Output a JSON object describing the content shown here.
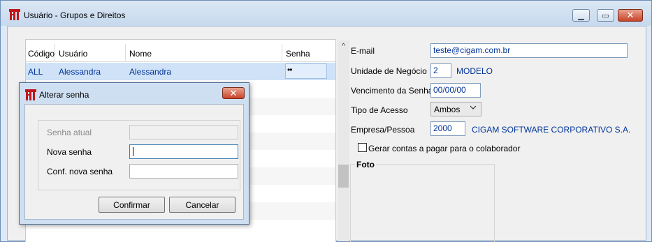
{
  "window": {
    "title": "Usuário - Grupos e Direitos",
    "minimize_glyph": "▁",
    "maximize_glyph": "▭",
    "close_glyph": "✕"
  },
  "grid": {
    "columns": [
      "Código",
      "Usuário",
      "Nome",
      "Senha"
    ],
    "rows": [
      {
        "codigo": "ALL",
        "usuario": "Alessandra",
        "nome": "Alessandra",
        "senha": "••"
      }
    ],
    "scroll_up_glyph": "^"
  },
  "form": {
    "email_label": "E-mail",
    "email_value": "teste@cigam.com.br",
    "unidade_label": "Unidade de Negócio",
    "unidade_code": "2",
    "unidade_name": "MODELO",
    "vencimento_label": "Vencimento da Senha",
    "vencimento_value": "00/00/00",
    "tipo_label": "Tipo de Acesso",
    "tipo_value": "Ambos",
    "empresa_label": "Empresa/Pessoa",
    "empresa_code": "2000",
    "empresa_name": "CIGAM SOFTWARE CORPORATIVO S.A.",
    "gerar_label": "Gerar contas a pagar para o colaborador",
    "gerar_checked": false,
    "foto_label": "Foto"
  },
  "dialog": {
    "title": "Alterar senha",
    "close_glyph": "✕",
    "senha_atual_label": "Senha atual",
    "nova_senha_label": "Nova senha",
    "conf_label": "Conf. nova senha",
    "confirm_label": "Confirmar",
    "cancel_label": "Cancelar"
  },
  "colors": {
    "title_bg": "#c7d9ee",
    "selection": "#cfe2f7",
    "value_text": "#003399",
    "close_button": "#c8442a",
    "brand_icon": "#c0161b"
  },
  "icons": [
    "app-logo-icon",
    "dropdown-chevron-icon",
    "scroll-up-icon"
  ]
}
